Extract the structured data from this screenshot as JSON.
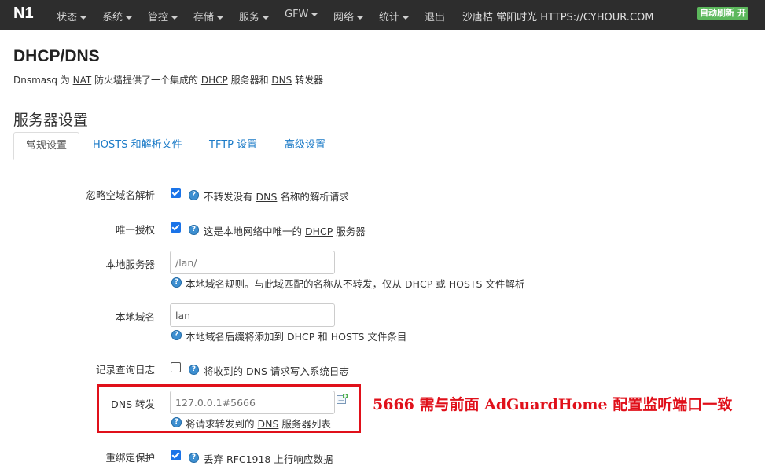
{
  "navbar": {
    "brand": "N1",
    "items": [
      {
        "label": "状态",
        "dropdown": true
      },
      {
        "label": "系统",
        "dropdown": true
      },
      {
        "label": "管控",
        "dropdown": true
      },
      {
        "label": "存储",
        "dropdown": true
      },
      {
        "label": "服务",
        "dropdown": true
      },
      {
        "label": "GFW",
        "dropdown": true
      },
      {
        "label": "网络",
        "dropdown": true
      },
      {
        "label": "统计",
        "dropdown": true
      },
      {
        "label": "退出",
        "dropdown": false
      }
    ],
    "hostname": "沙唐桔 常阳时光 HTTPS://CYHOUR.COM",
    "auto_refresh": "自动刷新 开"
  },
  "page": {
    "title": "DHCP/DNS",
    "description_parts": {
      "p1": "Dnsmasq 为 ",
      "nat": "NAT",
      "p2": " 防火墙提供了一个集成的 ",
      "dhcp": "DHCP",
      "p3": " 服务器和 ",
      "dns": "DNS",
      "p4": " 转发器"
    }
  },
  "section": {
    "title": "服务器设置",
    "tabs": [
      {
        "label": "常规设置",
        "active": true
      },
      {
        "label": "HOSTS 和解析文件",
        "active": false
      },
      {
        "label": "TFTP 设置",
        "active": false
      },
      {
        "label": "高级设置",
        "active": false
      }
    ]
  },
  "fields": {
    "domain_needed": {
      "label": "忽略空域名解析",
      "checked": true,
      "desc_a": "不转发没有 ",
      "desc_abbr": "DNS",
      "desc_b": " 名称的解析请求"
    },
    "authoritative": {
      "label": "唯一授权",
      "checked": true,
      "desc_a": "这是本地网络中唯一的 ",
      "desc_abbr": "DHCP",
      "desc_b": " 服务器"
    },
    "local_server": {
      "label": "本地服务器",
      "placeholder": "/lan/",
      "desc": "本地域名规则。与此域匹配的名称从不转发，仅从 DHCP 或 HOSTS 文件解析"
    },
    "local_domain": {
      "label": "本地域名",
      "value": "lan",
      "desc": "本地域名后缀将添加到 DHCP 和 HOSTS 文件条目"
    },
    "log_queries": {
      "label": "记录查询日志",
      "checked": false,
      "desc": "将收到的 DNS 请求写入系统日志"
    },
    "dns_forward": {
      "label": "DNS 转发",
      "placeholder": "127.0.0.1#5666",
      "desc_a": "将请求转发到的 ",
      "desc_abbr": "DNS",
      "desc_b": " 服务器列表"
    },
    "rebind_protection": {
      "label": "重绑定保护",
      "checked": true,
      "desc": "丢弃 RFC1918 上行响应数据"
    }
  },
  "annotation": {
    "text": "5666 需与前面 AdGuardHome 配置监听端口一致",
    "color": "#e0101a"
  },
  "colors": {
    "navbar_bg": "#2d2d2d",
    "link": "#1a7ac7",
    "checkbox": "#1a73e8",
    "badge": "#5cb85c"
  }
}
